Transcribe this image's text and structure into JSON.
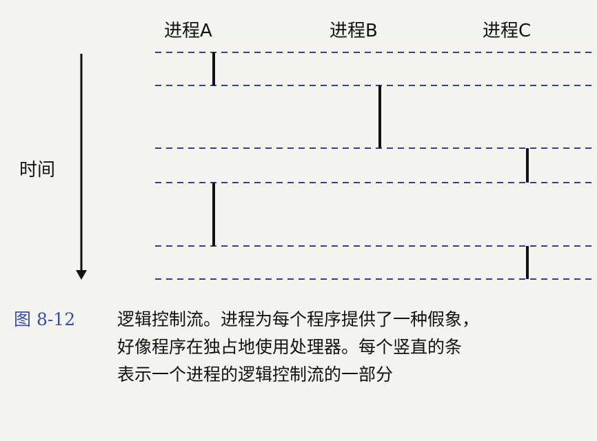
{
  "processes": [
    {
      "id": "A",
      "label": "进程A"
    },
    {
      "id": "B",
      "label": "进程B"
    },
    {
      "id": "C",
      "label": "进程C"
    }
  ],
  "time_axis": {
    "label": "时间"
  },
  "diagram": {
    "boundaries": [
      0,
      1,
      2,
      3,
      4,
      5
    ],
    "segments": [
      {
        "process": "A",
        "from": 0,
        "to": 1
      },
      {
        "process": "B",
        "from": 1,
        "to": 2
      },
      {
        "process": "C",
        "from": 2,
        "to": 3
      },
      {
        "process": "A",
        "from": 3,
        "to": 4
      },
      {
        "process": "C",
        "from": 4,
        "to": 5
      }
    ],
    "colors": {
      "dashed_line": "#2b3f94",
      "segment": "#111111",
      "arrow": "#111111"
    }
  },
  "caption": {
    "figure_number": "图 8-12",
    "lines": [
      "逻辑控制流。进程为每个程序提供了一种假象，",
      "好像程序在独占地使用处理器。每个竖直的条",
      "表示一个进程的逻辑控制流的一部分"
    ]
  }
}
